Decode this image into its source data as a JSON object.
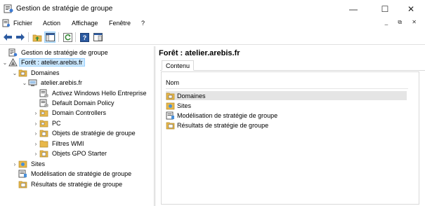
{
  "window": {
    "title": "Gestion de stratégie de groupe",
    "minimize_glyph": "—",
    "maximize_glyph": "☐",
    "close_glyph": "✕"
  },
  "menubar": {
    "items": [
      "Fichier",
      "Action",
      "Affichage",
      "Fenêtre",
      "?"
    ],
    "mdi_controls": "_ ⧉ ✕"
  },
  "toolbar": {
    "buttons": [
      "back-arrow-icon",
      "forward-arrow-icon",
      "up-folder-icon",
      "show-hide-console-tree-icon",
      "refresh-icon",
      "help-icon",
      "properties-icon"
    ]
  },
  "tree": {
    "root": "Gestion de stratégie de groupe",
    "forest": "Forêt : atelier.arebis.fr",
    "domains": "Domaines",
    "domain": "atelier.arebis.fr",
    "domain_children": [
      "Activez Windows Hello Entreprise",
      "Default Domain Policy",
      "Domain Controllers",
      "PC",
      "Objets de stratégie de groupe",
      "Filtres WMI",
      "Objets GPO Starter"
    ],
    "sites": "Sites",
    "modeling": "Modélisation de stratégie de groupe",
    "results": "Résultats de stratégie de groupe"
  },
  "right_pane": {
    "title": "Forêt : atelier.arebis.fr",
    "tab": "Contenu",
    "column_header": "Nom",
    "items": [
      "Domaines",
      "Sites",
      "Modélisation de stratégie de groupe",
      "Résultats de stratégie de groupe"
    ]
  },
  "colors": {
    "selection_bg": "#cce8ff",
    "folder": "#e8b84a",
    "arrow": "#2c5aa0"
  }
}
